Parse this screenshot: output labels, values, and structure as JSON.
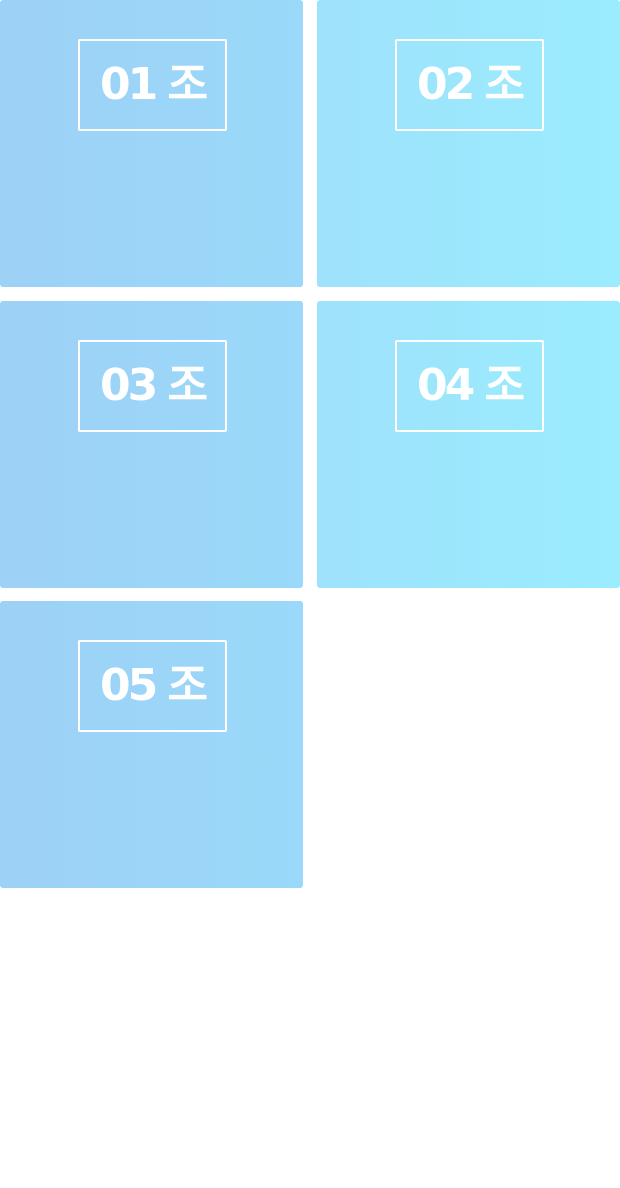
{
  "groups": [
    {
      "label": "01 조"
    },
    {
      "label": "02 조"
    },
    {
      "label": "03 조"
    },
    {
      "label": "04 조"
    },
    {
      "label": "05 조"
    }
  ],
  "colors": {
    "left_column_gradient": [
      "#9dd1f6",
      "#9ad9f9"
    ],
    "right_column_gradient": [
      "#9ee2fb",
      "#9aecfe"
    ],
    "label_color": "#ffffff",
    "page_background": "#ffffff"
  }
}
